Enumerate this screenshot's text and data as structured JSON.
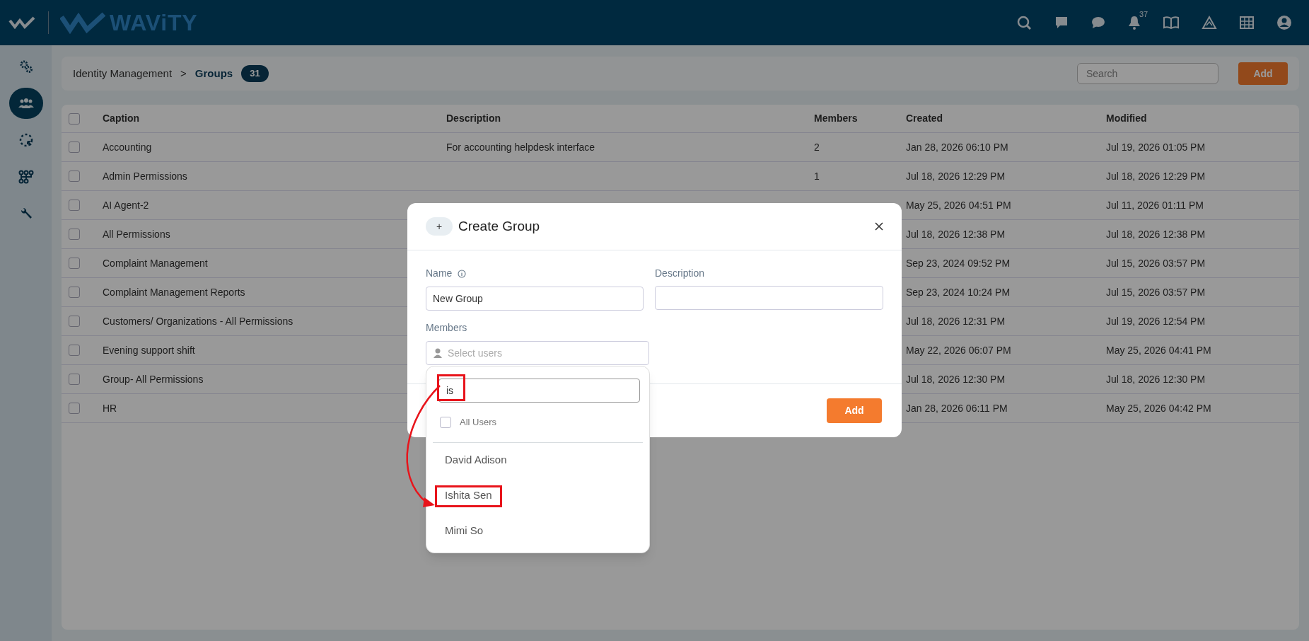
{
  "topbar": {
    "logo_text": "WAViTY",
    "notification_count": "37"
  },
  "sidebar": {
    "items": [
      {
        "kind": "gears",
        "selected": false
      },
      {
        "kind": "group",
        "selected": true
      },
      {
        "kind": "dashed-circle",
        "selected": false
      },
      {
        "kind": "network",
        "selected": false
      },
      {
        "kind": "wrench",
        "selected": false
      }
    ]
  },
  "breadcrumb": {
    "parent": "Identity Management",
    "separator": ">",
    "current": "Groups",
    "count": "31"
  },
  "search": {
    "placeholder": "Search"
  },
  "add_button": "Add",
  "table": {
    "header_checked": false,
    "columns": [
      "Caption",
      "Description",
      "Members",
      "Created",
      "Modified"
    ],
    "rows": [
      {
        "checked": false,
        "caption": "Accounting",
        "description": "For accounting helpdesk interface",
        "members": "2",
        "created": "Jan 28, 2026 06:10 PM",
        "modified": "Jul 19, 2026 01:05 PM"
      },
      {
        "checked": false,
        "caption": "Admin Permissions",
        "members": "1",
        "created": "Jul 18, 2026 12:29 PM",
        "modified": "Jul 18, 2026 12:29 PM"
      },
      {
        "checked": false,
        "caption": "AI Agent-2",
        "created": "May 25, 2026 04:51 PM",
        "modified": "Jul 11, 2026 01:11 PM"
      },
      {
        "checked": false,
        "caption": "All Permissions",
        "created": "Jul 18, 2026 12:38 PM",
        "modified": "Jul 18, 2026 12:38 PM"
      },
      {
        "checked": false,
        "caption": "Complaint Management",
        "created": "Sep 23, 2024 09:52 PM",
        "modified": "Jul 15, 2026 03:57 PM"
      },
      {
        "checked": false,
        "caption": "Complaint Management Reports",
        "created": "Sep 23, 2024 10:24 PM",
        "modified": "Jul 15, 2026 03:57 PM"
      },
      {
        "checked": false,
        "caption": "Customers/ Organizations - All Permissions",
        "created": "Jul 18, 2026 12:31 PM",
        "modified": "Jul 19, 2026 12:54 PM"
      },
      {
        "checked": false,
        "caption": "Evening support shift",
        "created": "May 22, 2026 06:07 PM",
        "modified": "May 25, 2026 04:41 PM"
      },
      {
        "checked": false,
        "caption": "Group- All Permissions",
        "created": "Jul 18, 2026 12:30 PM",
        "modified": "Jul 18, 2026 12:30 PM"
      },
      {
        "checked": false,
        "caption": "HR",
        "created": "Jan 28, 2026 06:11 PM",
        "modified": "May 25, 2026 04:42 PM"
      }
    ]
  },
  "modal": {
    "icon": "+",
    "title": "Create Group",
    "name_field": {
      "label": "Name",
      "info": true,
      "value": "New Group"
    },
    "description_field": {
      "label": "Description"
    },
    "members_field": {
      "label": "Members",
      "placeholder": "Select users"
    },
    "dropdown": {
      "search_value": "is",
      "search_highlighted": true,
      "all_users": {
        "label": "All Users",
        "checked": false
      },
      "options": [
        {
          "label": "David Adison",
          "highlighted": false
        },
        {
          "label": "Ishita Sen",
          "highlighted": true
        },
        {
          "label": "Mimi So",
          "highlighted": false
        }
      ]
    },
    "add_button": "Add"
  }
}
